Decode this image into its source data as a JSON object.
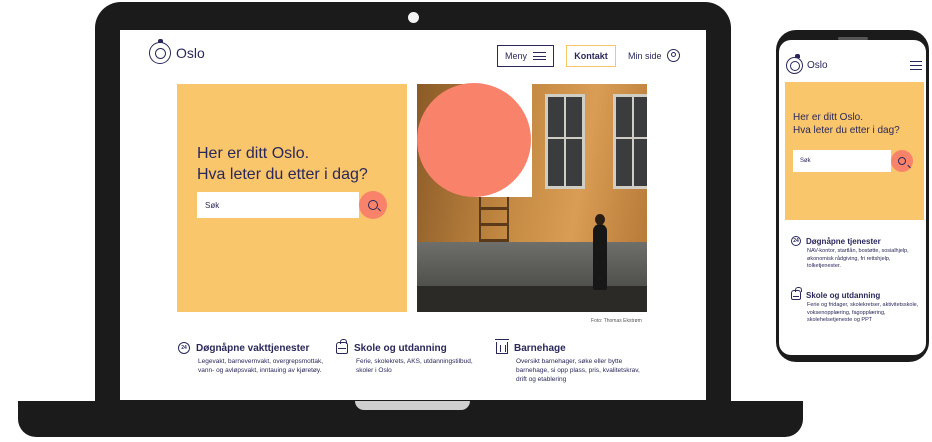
{
  "header": {
    "logo_text": "Oslo",
    "menu_label": "Meny",
    "contact_label": "Kontakt",
    "mypage_label": "Min side"
  },
  "hero": {
    "title_line1": "Her er ditt Oslo.",
    "title_line2": "Hva leter du etter i dag?",
    "search_placeholder": "Søk"
  },
  "photo": {
    "credit": "Foto: Thomas Ekstrøm"
  },
  "services": [
    {
      "title": "Døgnåpne vakttjenester",
      "icon": "24h-clock-icon",
      "description": "Legevakt, barnevernvakt, overgrepsmottak, vann- og avløpsvakt, inntauing av kjøretøy."
    },
    {
      "title": "Skole og utdanning",
      "icon": "backpack-icon",
      "description": "Ferie, skolekrets, AKS, utdanningstilbud, skoler i Oslo"
    },
    {
      "title": "Barnehage",
      "icon": "kindergarten-icon",
      "description": "Oversikt barnehager, søke eller bytte barnehage, si opp plass, pris, kvalitetskrav, drift og etablering"
    }
  ],
  "mobile": {
    "logo_text": "Oslo",
    "hero_line1": "Her er ditt Oslo.",
    "hero_line2": "Hva leter du etter i dag?",
    "search_placeholder": "Søk",
    "services": [
      {
        "title": "Døgnåpne tjenester",
        "icon": "24h-clock-icon",
        "description": "NAV-kontor, startlån, bostøtte, sosialhjelp, økonomisk rådgiving, fri rettshjelp, tolketjenester."
      },
      {
        "title": "Skole og utdanning",
        "icon": "backpack-icon",
        "description": "Ferie og fridager, skolekretser, aktivitetsskole, voksenopplæring, fagopplæring, skolehelsetjeneste og PPT"
      }
    ]
  },
  "colors": {
    "brand_blue": "#2a2859",
    "yellow": "#f9c66b",
    "coral": "#f9826b"
  }
}
